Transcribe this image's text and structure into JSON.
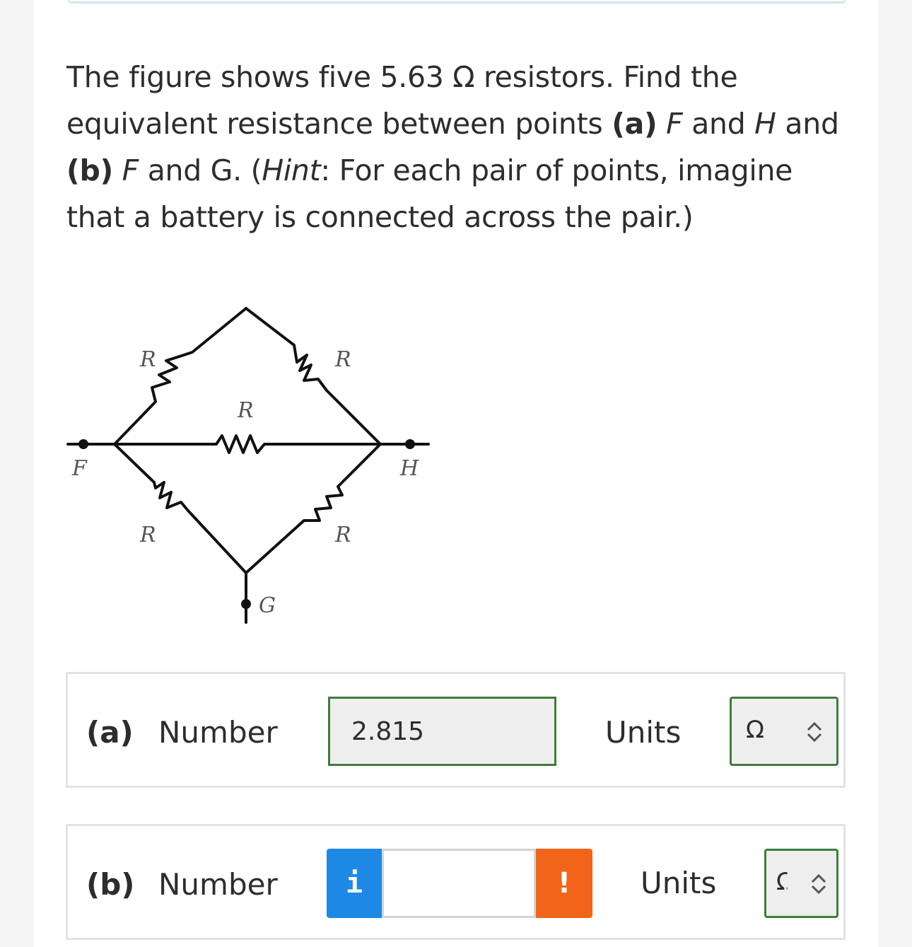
{
  "question": {
    "t1": "The figure shows five 5.63 Ω resistors. Find the equivalent resistance between points ",
    "pa": "(a)",
    "t2": " ",
    "F1": "F",
    "t3": " and ",
    "H": "H",
    "t4": " and ",
    "pb": "(b)",
    "t5": " ",
    "F2": "F",
    "t6": " and G. (",
    "hint": "Hint",
    "t7": ": For each pair of points, imagine that a battery is connected across the pair.)"
  },
  "figure": {
    "labels": {
      "r_top_left": "R",
      "r_top_right": "R",
      "r_middle": "R",
      "r_bottom_left": "R",
      "r_bottom_right": "R",
      "node_f": "F",
      "node_h": "H",
      "node_g": "G"
    }
  },
  "part_a": {
    "part_label": "(a)",
    "number_label": "Number",
    "value": "2.815",
    "units_label": "Units",
    "units_value": "Ω"
  },
  "part_b": {
    "part_label": "(b)",
    "number_label": "Number",
    "info_label": "i",
    "value": "",
    "warn_label": "!",
    "units_label": "Units",
    "units_value": "Ω"
  },
  "colors": {
    "accent_green": "#3f7d3a",
    "info_blue": "#1e88e5",
    "warn_orange": "#f26419"
  }
}
